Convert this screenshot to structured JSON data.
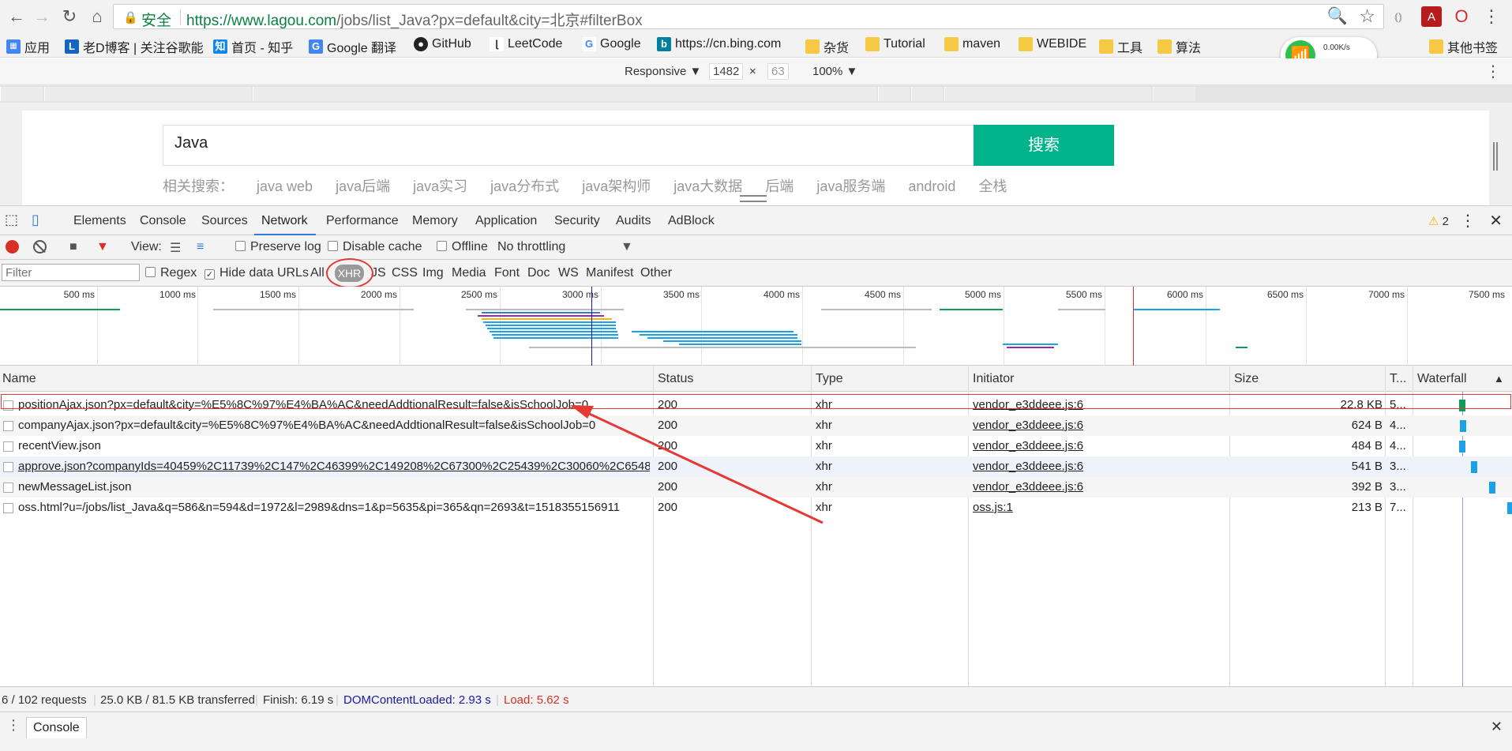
{
  "browser": {
    "url_secure_label": "安全",
    "url_host": "https://www.lagou.com",
    "url_rest": "/jobs/list_Java?px=default&city=北京#filterBox",
    "bookmarks": [
      "应用",
      "老D博客 | 关注谷歌能",
      "首页 - 知乎",
      "Google 翻译",
      "GitHub",
      "LeetCode",
      "Google",
      "https://cn.bing.com",
      "杂货",
      "Tutorial",
      "maven",
      "WEBIDE",
      "工具",
      "算法",
      "其他书签"
    ],
    "net_speed": {
      "down": "0.00K/s",
      "up": "0"
    }
  },
  "device_toolbar": {
    "mode": "Responsive ▼",
    "width": "1482",
    "times": "×",
    "height": "63",
    "zoom": "100% ▼"
  },
  "page": {
    "search_value": "Java",
    "search_button": "搜索",
    "related_label": "相关搜索：",
    "related": [
      "java web",
      "java后端",
      "java实习",
      "java分布式",
      "java架构师",
      "java大数据",
      "后端",
      "java服务端",
      "android",
      "全栈"
    ]
  },
  "devtools": {
    "tabs": [
      "Elements",
      "Console",
      "Sources",
      "Network",
      "Performance",
      "Memory",
      "Application",
      "Security",
      "Audits",
      "AdBlock"
    ],
    "warning_count": "2"
  },
  "network_toolbar": {
    "view_label": "View:",
    "preserve_log": "Preserve log",
    "disable_cache": "Disable cache",
    "offline": "Offline",
    "throttling": "No throttling"
  },
  "filter_bar": {
    "placeholder": "Filter",
    "regex": "Regex",
    "hide_data_urls": "Hide data URLs",
    "types": [
      "All",
      "XHR",
      "JS",
      "CSS",
      "Img",
      "Media",
      "Font",
      "Doc",
      "WS",
      "Manifest",
      "Other"
    ]
  },
  "overview": {
    "ticks": [
      "500 ms",
      "1000 ms",
      "1500 ms",
      "2000 ms",
      "2500 ms",
      "3000 ms",
      "3500 ms",
      "4000 ms",
      "4500 ms",
      "5000 ms",
      "5500 ms",
      "6000 ms",
      "6500 ms",
      "7000 ms",
      "7500 ms"
    ]
  },
  "table": {
    "headers": {
      "name": "Name",
      "status": "Status",
      "type": "Type",
      "initiator": "Initiator",
      "size": "Size",
      "time": "T...",
      "waterfall": "Waterfall"
    },
    "rows": [
      {
        "name": "positionAjax.json?px=default&city=%E5%8C%97%E4%BA%AC&needAddtionalResult=false&isSchoolJob=0",
        "status": "200",
        "type": "xhr",
        "initiator": "vendor_e3ddeee.js:6",
        "size": "22.8 KB",
        "time": "5..."
      },
      {
        "name": "companyAjax.json?px=default&city=%E5%8C%97%E4%BA%AC&needAddtionalResult=false&isSchoolJob=0",
        "status": "200",
        "type": "xhr",
        "initiator": "vendor_e3ddeee.js:6",
        "size": "624 B",
        "time": "4..."
      },
      {
        "name": "recentView.json",
        "status": "200",
        "type": "xhr",
        "initiator": "vendor_e3ddeee.js:6",
        "size": "484 B",
        "time": "4..."
      },
      {
        "name": "approve.json?companyIds=40459%2C11739%2C147%2C46399%2C149208%2C67300%2C25439%2C30060%2C65482%...",
        "status": "200",
        "type": "xhr",
        "initiator": "vendor_e3ddeee.js:6",
        "size": "541 B",
        "time": "3..."
      },
      {
        "name": "newMessageList.json",
        "status": "200",
        "type": "xhr",
        "initiator": "vendor_e3ddeee.js:6",
        "size": "392 B",
        "time": "3..."
      },
      {
        "name": "oss.html?u=/jobs/list_Java&q=586&n=594&d=1972&l=2989&dns=1&p=5635&pi=365&qn=2693&t=1518355156911",
        "status": "200",
        "type": "xhr",
        "initiator": "oss.js:1",
        "size": "213 B",
        "time": "7..."
      }
    ]
  },
  "status_bar": {
    "requests": "6 / 102 requests",
    "transferred": "25.0 KB / 81.5 KB transferred",
    "finish": "Finish: 6.19 s",
    "dom_loaded": "DOMContentLoaded: 2.93 s",
    "load": "Load: 5.62 s"
  },
  "drawer": {
    "tab": "Console"
  },
  "colors": {
    "accent": "#00b38a",
    "selected_tab": "#3879d9",
    "dom_blue": "#1a1aa6",
    "load_red": "#d93025",
    "annotation_red": "#e53935"
  }
}
